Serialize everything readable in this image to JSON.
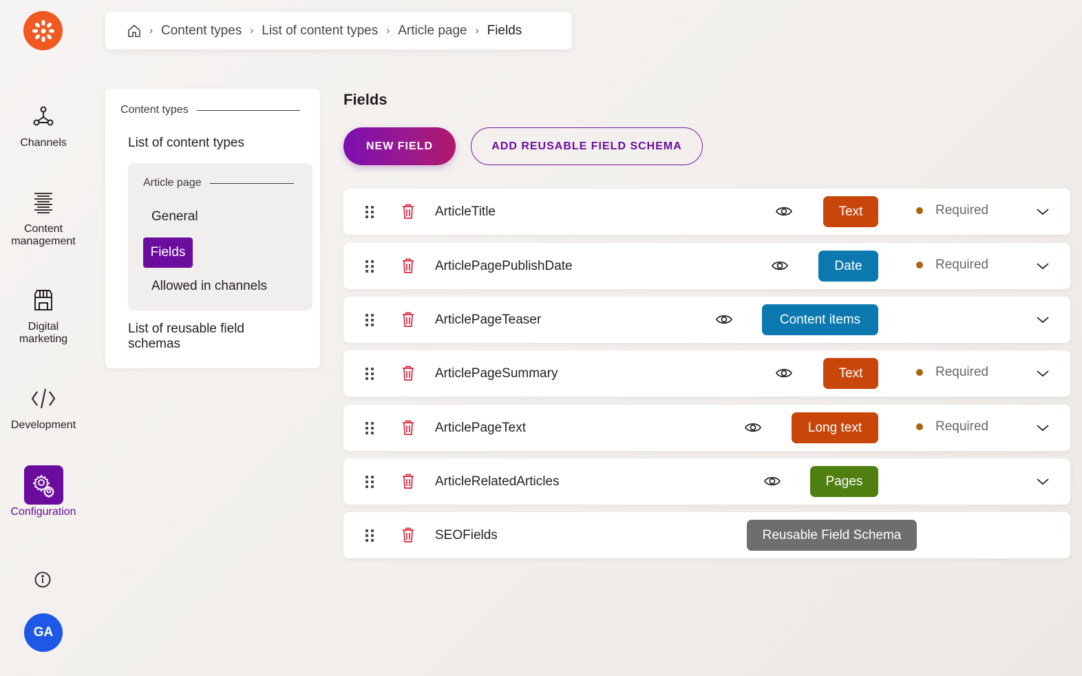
{
  "app": {
    "logo": "kentico-logo-icon",
    "accent": "#6a0d9e",
    "brand": "#f05a22"
  },
  "rail": {
    "items": [
      {
        "label": "Channels",
        "icon": "channels-icon"
      },
      {
        "label": "Content management",
        "icon": "content-management-icon"
      },
      {
        "label": "Digital marketing",
        "icon": "storefront-icon"
      },
      {
        "label": "Development",
        "icon": "code-icon"
      },
      {
        "label": "Configuration",
        "icon": "gear-icon",
        "active": true
      }
    ],
    "avatar": "GA"
  },
  "breadcrumb": {
    "items": [
      "Content types",
      "List of content types",
      "Article page",
      "Fields"
    ]
  },
  "panel": {
    "section": "Content types",
    "list_link": "List of content types",
    "group_title": "Article page",
    "group_items": [
      "General",
      "Fields",
      "Allowed in channels"
    ],
    "selected": "Fields",
    "reusable_link": "List of reusable field schemas"
  },
  "main": {
    "title": "Fields",
    "new_field": "NEW FIELD",
    "add_schema": "ADD REUSABLE FIELD SCHEMA",
    "fields": [
      {
        "name": "ArticleTitle",
        "type": "Text",
        "type_color": "#c8460a",
        "required": "Required"
      },
      {
        "name": "ArticlePagePublishDate",
        "type": "Date",
        "type_color": "#0b78b0",
        "required": "Required"
      },
      {
        "name": "ArticlePageTeaser",
        "type": "Content items",
        "type_color": "#0b78b0",
        "required": ""
      },
      {
        "name": "ArticlePageSummary",
        "type": "Text",
        "type_color": "#c8460a",
        "required": "Required"
      },
      {
        "name": "ArticlePageText",
        "type": "Long text",
        "type_color": "#c8460a",
        "required": "Required"
      },
      {
        "name": "ArticleRelatedArticles",
        "type": "Pages",
        "type_color": "#4f7f11",
        "required": ""
      },
      {
        "name": "SEOFields",
        "type": "Reusable Field Schema",
        "type_color": "#6e6e6e",
        "required": ""
      }
    ]
  }
}
